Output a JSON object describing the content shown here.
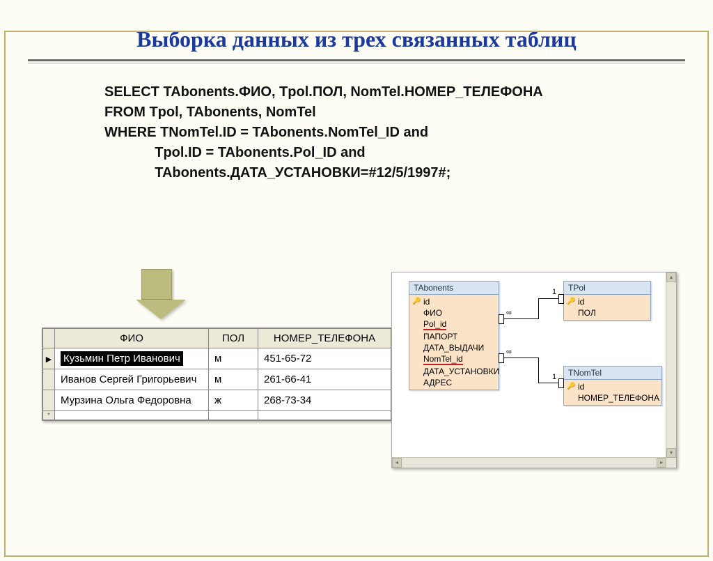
{
  "title": "Выборка данных из трех связанных таблиц",
  "sql": {
    "kw_select": "SELECT",
    "select_cols": " TAbonents.ФИО, Tpol.ПОЛ, NomTel.НОМЕР_ТЕЛЕФОНА",
    "kw_from": "FROM",
    "from_tables": " Tpol, TAbonents, NomTel",
    "kw_where": "WHERE",
    "where_1": " TNomTel.ID = TAbonents.NomTel_ID ",
    "kw_and_1": "and",
    "where_2_pre": "             Tpol.ID = TAbonents.Pol_ID ",
    "kw_and_2": "and",
    "where_3": "             TAbonents.ДАТА_УСТАНОВКИ=#12/5/1997#;"
  },
  "datasheet": {
    "cols": [
      "ФИО",
      "ПОЛ",
      "НОМЕР_ТЕЛЕФОНА"
    ],
    "rows": [
      {
        "fio": "Кузьмин Петр Иванович",
        "pol": "м",
        "tel": "451-65-72",
        "current": true
      },
      {
        "fio": "Иванов Сергей Григорьевич",
        "pol": "м",
        "tel": "261-66-41",
        "current": false
      },
      {
        "fio": "Мурзина Ольга Федоровна",
        "pol": "ж",
        "tel": "268-73-34",
        "current": false
      }
    ]
  },
  "relations": {
    "tabonents": {
      "title": "TAbonents",
      "fields": [
        "id",
        "ФИО",
        "Pol_id",
        "ПАПОРТ",
        "ДАТА_ВЫДАЧИ",
        "NomTel_id",
        "ДАТА_УСТАНОВКИ",
        "АДРЕС"
      ]
    },
    "tpol": {
      "title": "TPol",
      "fields": [
        "id",
        "ПОЛ"
      ]
    },
    "tnomtel": {
      "title": "TNomTel",
      "fields": [
        "id",
        "НОМЕР_ТЕЛЕФОНА"
      ]
    },
    "cardinality": {
      "one": "1",
      "many": "∞"
    }
  }
}
